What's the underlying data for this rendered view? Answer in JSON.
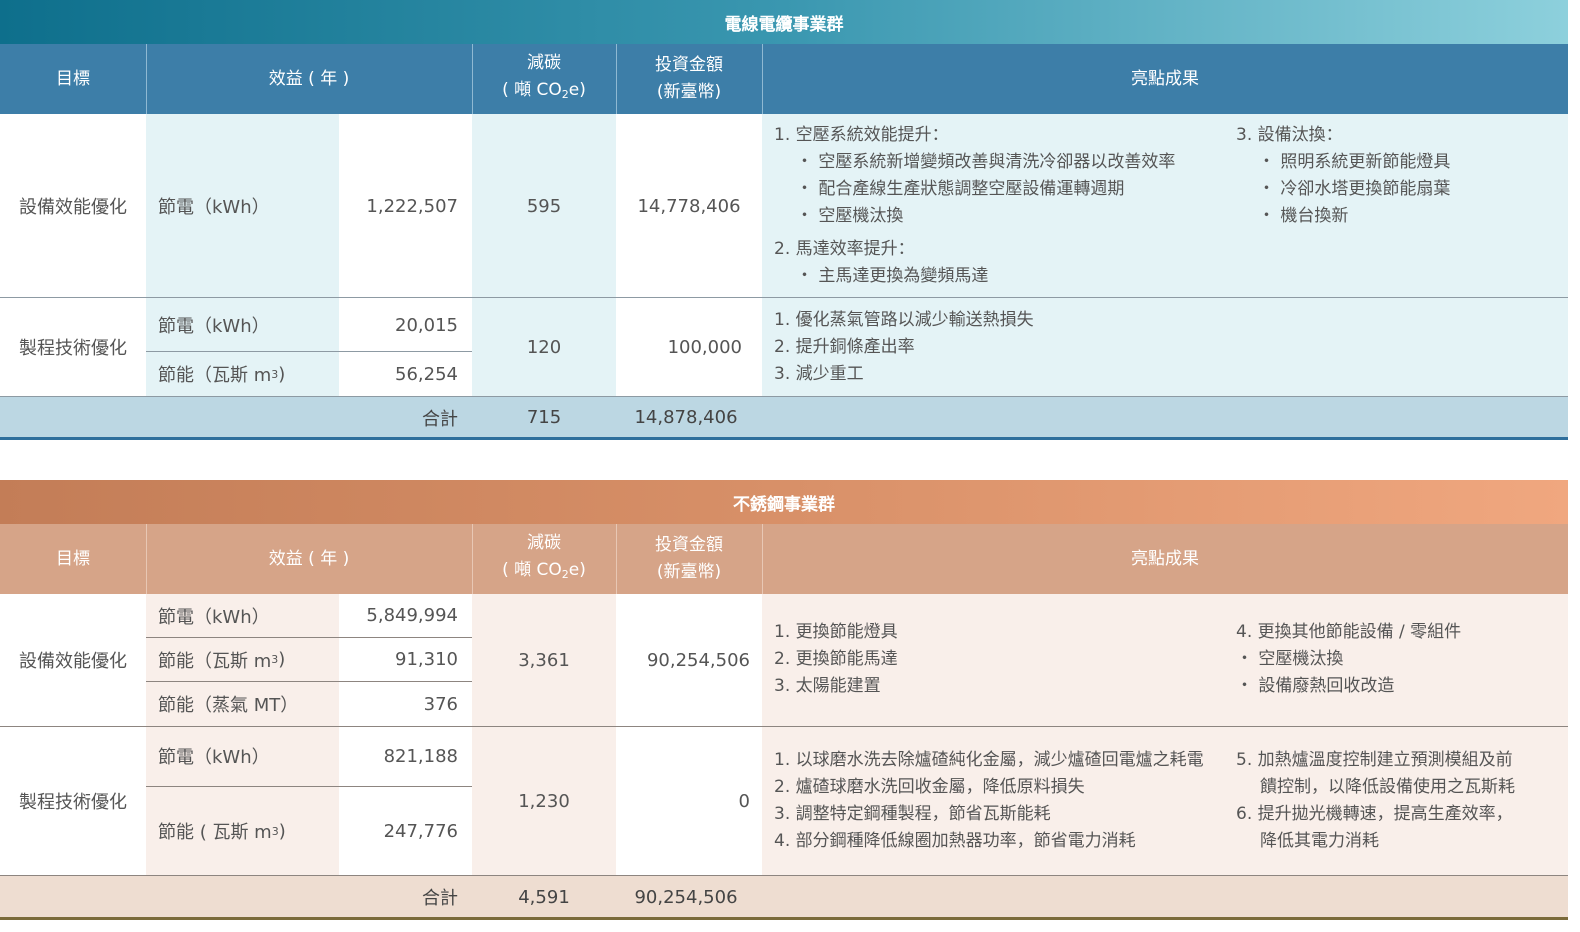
{
  "colors": {
    "teal_dark": "#0e6f8c",
    "teal_light": "#6cbfd0",
    "header_blue": "#3d7ea8",
    "stripe_blue": "#e4f3f6",
    "total_blue": "#bcd7e3",
    "brown_dark": "#c37d57",
    "brown_light": "#f0a77f",
    "header_brown": "#d6a488",
    "stripe_brown": "#f9efea",
    "total_brown": "#eeddd1"
  },
  "wire": {
    "title": "電線電纜事業群",
    "headers": {
      "target": "目標",
      "benefit": "效益 ( 年 )",
      "carbon_line1": "減碳",
      "carbon_line2a": "( 噸 CO",
      "carbon_sub": "2",
      "carbon_line2b": "e)",
      "invest_line1": "投資金額",
      "invest_line2": "(新臺幣)",
      "highlight": "亮點成果"
    },
    "row1": {
      "target": "設備效能優化",
      "label": "節電（kWh）",
      "value": "1,222,507",
      "carbon": "595",
      "invest": "14,778,406",
      "col1": [
        "1. 空壓系統效能提升：",
        "・ 空壓系統新增變頻改善與清洗冷卻器以改善效率",
        "・ 配合產線生產狀態調整空壓設備運轉週期",
        "・ 空壓機汰換",
        "2. 馬達效率提升：",
        "・ 主馬達更換為變頻馬達"
      ],
      "col2": [
        "3. 設備汰換：",
        "・ 照明系統更新節能燈具",
        "・ 冷卻水塔更換節能扇葉",
        "・ 機台換新"
      ]
    },
    "row2": {
      "target": "製程技術優化",
      "label1": "節電（kWh）",
      "value1": "20,015",
      "label2a": "節能（瓦斯 m",
      "label2sup": "3",
      "label2b": ")",
      "value2": "56,254",
      "carbon": "120",
      "invest": "100,000",
      "col1": [
        "1. 優化蒸氣管路以減少輸送熱損失",
        "2. 提升銅條產出率",
        "3. 減少重工"
      ]
    },
    "total": {
      "label": "合計",
      "carbon": "715",
      "invest": "14,878,406"
    }
  },
  "steel": {
    "title": "不銹鋼事業群",
    "headers": {
      "target": "目標",
      "benefit": "效益 ( 年 )",
      "carbon_line1": "減碳",
      "carbon_line2a": "( 噸 CO",
      "carbon_sub": "2",
      "carbon_line2b": "e)",
      "invest_line1": "投資金額",
      "invest_line2": "(新臺幣)",
      "highlight": "亮點成果"
    },
    "row1": {
      "target": "設備效能優化",
      "label1": "節電（kWh）",
      "value1": "5,849,994",
      "label2a": "節能（瓦斯 m",
      "label2sup": "3",
      "label2b": ")",
      "value2": "91,310",
      "label3": "節能（蒸氣 MT）",
      "value3": "376",
      "carbon": "3,361",
      "invest": "90,254,506",
      "col1": [
        "1. 更換節能燈具",
        "2. 更換節能馬達",
        "3. 太陽能建置"
      ],
      "col2": [
        "4. 更換其他節能設備 / 零組件",
        "・ 空壓機汰換",
        "・ 設備廢熱回收改造"
      ]
    },
    "row2": {
      "target": "製程技術優化",
      "label1": "節電（kWh）",
      "value1": "821,188",
      "label2a": "節能 ( 瓦斯 m",
      "label2sup": "3",
      "label2b": ")",
      "value2": "247,776",
      "carbon": "1,230",
      "invest": "0",
      "col1": [
        "1. 以球磨水洗去除爐碴純化金屬，減少爐碴回電爐之耗電",
        "2. 爐碴球磨水洗回收金屬，降低原料損失",
        "3. 調整特定鋼種製程，節省瓦斯能耗",
        "4. 部分鋼種降低線圈加熱器功率，節省電力消耗"
      ],
      "col2": [
        "5. 加熱爐溫度控制建立預測模組及前",
        "饋控制，以降低設備使用之瓦斯耗",
        "6. 提升拋光機轉速，提高生產效率，",
        "降低其電力消耗"
      ]
    },
    "total": {
      "label": "合計",
      "carbon": "4,591",
      "invest": "90,254,506"
    }
  }
}
